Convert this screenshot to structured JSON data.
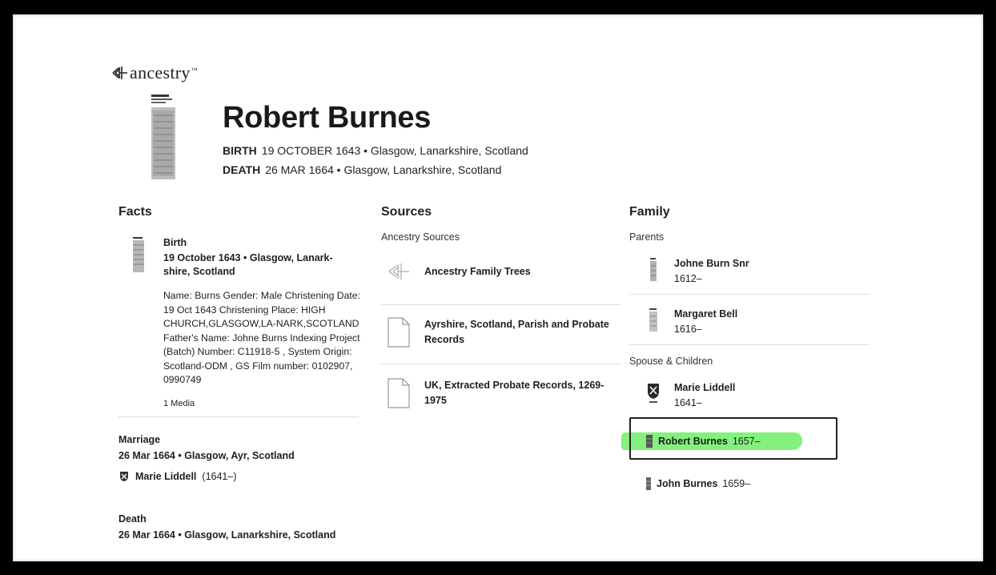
{
  "brand": {
    "name": "ancestry",
    "tm": "™"
  },
  "person": {
    "name": "Robert Burnes",
    "birth_label": "BIRTH",
    "birth_value": "19 OCTOBER 1643 • Glasgow, Lanarkshire, Scotland",
    "death_label": "DEATH",
    "death_value": "26 MAR 1664 • Glasgow, Lanarkshire, Scotland"
  },
  "facts": {
    "heading": "Facts",
    "birth": {
      "title": "Birth",
      "detail": "19 October 1643 • Glasgow, Lanark-shire, Scotland",
      "body": "Name: Burns Gender: Male Christening Date: 19 Oct 1643 Christening Place: HIGH CHURCH,GLASGOW,LA-NARK,SCOTLAND Father's Name: Johne Burns Indexing Project (Batch) Number: C11918-5 , System Origin: Scotland-ODM , GS Film number: 0102907, 0990749",
      "media": "1 Media"
    },
    "marriage": {
      "title": "Marriage",
      "detail": "26 Mar 1664 • Glasgow, Ayr, Scotland",
      "spouse_name": "Marie Liddell",
      "spouse_years": "(1641–)"
    },
    "death": {
      "title": "Death",
      "detail": "26 Mar 1664 • Glasgow, Lanarkshire, Scotland"
    }
  },
  "sources": {
    "heading": "Sources",
    "subheading": "Ancestry Sources",
    "items": [
      {
        "label": "Ancestry Family Trees",
        "icon": "ancestry-leaf-icon"
      },
      {
        "label": "Ayrshire, Scotland, Parish and Probate Records",
        "icon": "document-icon"
      },
      {
        "label": "UK, Extracted Probate Records, 1269-1975",
        "icon": "document-icon"
      }
    ]
  },
  "family": {
    "heading": "Family",
    "parents_label": "Parents",
    "parents": [
      {
        "name": "Johne Burn Snr",
        "years": "1612–"
      },
      {
        "name": "Margaret Bell",
        "years": "1616–"
      }
    ],
    "spouse_label": "Spouse & Children",
    "spouse": {
      "name": "Marie Liddell",
      "years": "1641–"
    },
    "children": [
      {
        "name": "Robert Burnes",
        "years": "1657–"
      },
      {
        "name": "John Burnes",
        "years": "1659–"
      }
    ]
  },
  "colors": {
    "highlight": "#76ef6f",
    "frame": "#000000",
    "text": "#1f1f1f"
  }
}
